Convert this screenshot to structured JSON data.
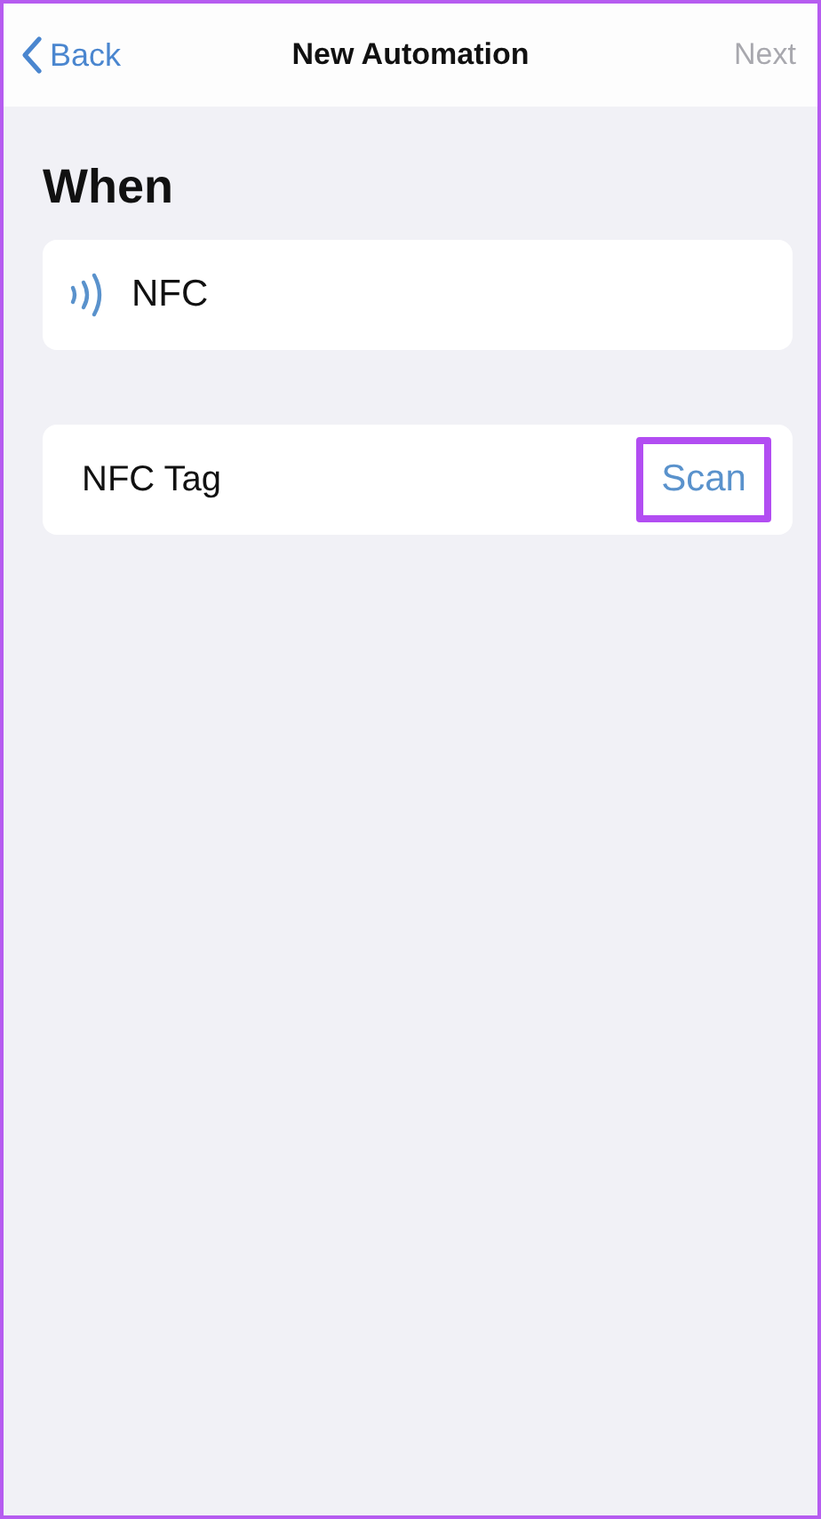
{
  "nav_bar": {
    "back": "Back",
    "title": "New Automation",
    "next": {
      "label": "Next",
      "disabled": true
    }
  },
  "section_title": "When",
  "trigger": {
    "label": "NFC"
  },
  "rows": [
    {
      "label": "NFC Tag",
      "action": {
        "label": "Scan",
        "highlighted": true
      }
    }
  ]
}
